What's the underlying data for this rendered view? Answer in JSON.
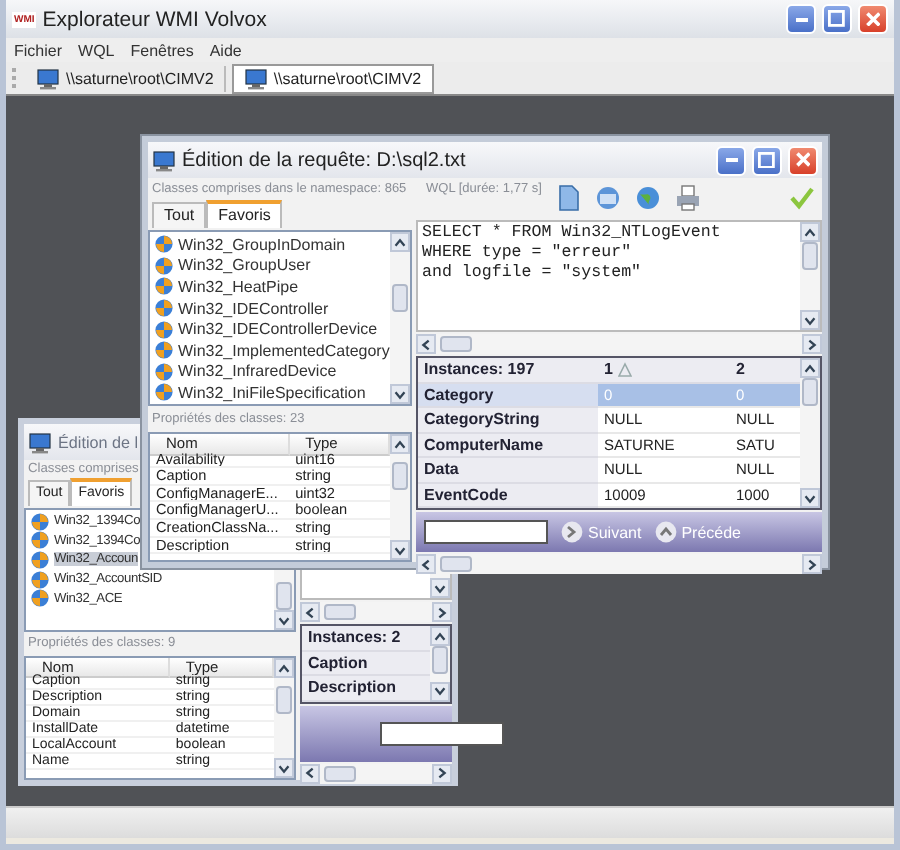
{
  "window": {
    "title": "Explorateur WMI Volvox",
    "icon_text": "WMI"
  },
  "menu": [
    {
      "label": "Fichier"
    },
    {
      "label": "WQL"
    },
    {
      "label": "Fenêtres"
    },
    {
      "label": "Aide"
    }
  ],
  "connection_tabs": [
    {
      "label": "\\\\saturne\\root\\CIMV2",
      "selected": false
    },
    {
      "label": "\\\\saturne\\root\\CIMV2",
      "selected": true
    }
  ],
  "query_windows": [
    {
      "title": "Édition de l",
      "active": false,
      "classes_caption": "Classes comprises",
      "class_tabs": [
        {
          "label": "Tout",
          "selected": false
        },
        {
          "label": "Favoris",
          "selected": true
        }
      ],
      "classes": [
        {
          "name": "Win32_1394Co",
          "selected": false
        },
        {
          "name": "Win32_1394Co",
          "selected": false
        },
        {
          "name": "Win32_Accoun",
          "selected": true
        },
        {
          "name": "Win32_AccountSID",
          "selected": false
        },
        {
          "name": "Win32_ACE",
          "selected": false
        }
      ],
      "properties_caption": "Propriétés des classes: 9",
      "property_columns": [
        "Nom",
        "Type"
      ],
      "properties": [
        [
          "Caption",
          "string"
        ],
        [
          "Description",
          "string"
        ],
        [
          "Domain",
          "string"
        ],
        [
          "InstallDate",
          "datetime"
        ],
        [
          "LocalAccount",
          "boolean"
        ],
        [
          "Name",
          "string"
        ]
      ],
      "results": {
        "header": "Instances: 2",
        "rows": [
          {
            "name": "Caption",
            "selected": false
          },
          {
            "name": "Description",
            "selected": false
          }
        ]
      }
    },
    {
      "title": "Édition de la requête: D:\\sql2.txt",
      "active": true,
      "classes_caption": "Classes comprises dans le namespace: 865",
      "class_tabs": [
        {
          "label": "Tout",
          "selected": false
        },
        {
          "label": "Favoris",
          "selected": true
        }
      ],
      "classes": [
        {
          "name": "Win32_GroupInDomain",
          "selected": false
        },
        {
          "name": "Win32_GroupUser",
          "selected": false
        },
        {
          "name": "Win32_HeatPipe",
          "selected": false
        },
        {
          "name": "Win32_IDEController",
          "selected": false
        },
        {
          "name": "Win32_IDEControllerDevice",
          "selected": false
        },
        {
          "name": "Win32_ImplementedCategory",
          "selected": false
        },
        {
          "name": "Win32_InfraredDevice",
          "selected": false
        },
        {
          "name": "Win32_IniFileSpecification",
          "selected": false
        }
      ],
      "properties_caption": "Propriétés des classes: 23",
      "property_columns": [
        "Nom",
        "Type"
      ],
      "properties": [
        [
          "Availability",
          "uint16"
        ],
        [
          "Caption",
          "string"
        ],
        [
          "ConfigManagerE...",
          "uint32"
        ],
        [
          "ConfigManagerU...",
          "boolean"
        ],
        [
          "CreationClassNa...",
          "string"
        ],
        [
          "Description",
          "string"
        ]
      ],
      "toolbar_caption": "WQL [durée: 1,77 s]",
      "query": [
        "SELECT * FROM Win32_NTLogEvent",
        "WHERE type = \"erreur\"",
        "and logfile = \"system\""
      ],
      "results": {
        "header": "Instances: 197",
        "columns": [
          {
            "label": "1",
            "sorted": true
          },
          {
            "label": "2",
            "sorted": false
          }
        ],
        "rows": [
          {
            "name": "Category",
            "selected": true,
            "values": [
              "0",
              "0"
            ]
          },
          {
            "name": "CategoryString",
            "selected": false,
            "values": [
              "NULL",
              "NULL"
            ]
          },
          {
            "name": "ComputerName",
            "selected": false,
            "values": [
              "SATURNE",
              "SATU"
            ]
          },
          {
            "name": "Data",
            "selected": false,
            "values": [
              "NULL",
              "NULL"
            ]
          },
          {
            "name": "EventCode",
            "selected": false,
            "values": [
              "10009",
              "1000"
            ]
          }
        ]
      },
      "nav_buttons": [
        {
          "label": "Suivant",
          "kind": "next"
        },
        {
          "label": "Précéde",
          "kind": "previous"
        }
      ]
    }
  ]
}
